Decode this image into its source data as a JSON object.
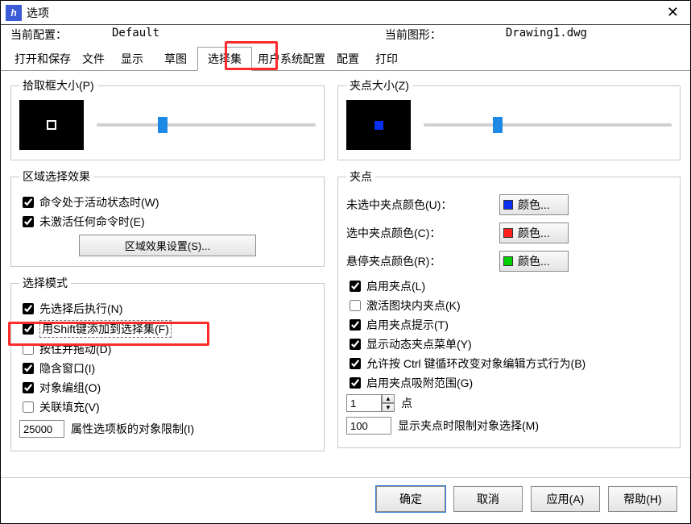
{
  "window": {
    "title": "选项"
  },
  "config": {
    "current_config_label": "当前配置：",
    "current_config_value": "Default",
    "current_drawing_label": "当前图形：",
    "current_drawing_value": "Drawing1.dwg"
  },
  "tabs": {
    "open_save": "打开和保存",
    "file": "文件",
    "display": "显示",
    "draft": "草图",
    "selection": "选择集",
    "user_pref": "用户系统配置",
    "profiles": "配置",
    "print": "打印"
  },
  "pickbox": {
    "legend": "拾取框大小(P)"
  },
  "gripsize": {
    "legend": "夹点大小(Z)"
  },
  "region_effect": {
    "legend": "区域选择效果",
    "cmd_active": "命令处于活动状态时(W)",
    "no_cmd_active": "未激活任何命令时(E)",
    "settings_btn": "区域效果设置(S)..."
  },
  "select_mode": {
    "legend": "选择模式",
    "noun_verb": "先选择后执行(N)",
    "shift_add": "用Shift键添加到选择集(F)",
    "press_drag": "按住并拖动(D)",
    "implied_window": "隐含窗口(I)",
    "object_group": "对象编组(O)",
    "assoc_hatch": "关联填充(V)",
    "limit_value": "25000",
    "limit_label": "属性选项板的对象限制(I)"
  },
  "grips": {
    "legend": "夹点",
    "unselected_label": "未选中夹点颜色(U)：",
    "selected_label": "选中夹点颜色(C)：",
    "hover_label": "悬停夹点颜色(R)：",
    "color_btn": "颜色...",
    "colors": {
      "unselected": "#0a2ef0",
      "selected": "#ff2020",
      "hover": "#00d000"
    },
    "enable_grips": "启用夹点(L)",
    "grips_in_blocks": "激活图块内夹点(K)",
    "grip_tips": "启用夹点提示(T)",
    "dyn_grip_menu": "显示动态夹点菜单(Y)",
    "allow_ctrl_cycle": "允许按 Ctrl 键循环改变对象编辑方式行为(B)",
    "enable_grip_snap": "启用夹点吸附范围(G)",
    "spin_value": "1",
    "spin_label": "点",
    "limit_value": "100",
    "limit_label": "显示夹点时限制对象选择(M)"
  },
  "buttons": {
    "ok": "确定",
    "cancel": "取消",
    "apply": "应用(A)",
    "help": "帮助(H)"
  }
}
